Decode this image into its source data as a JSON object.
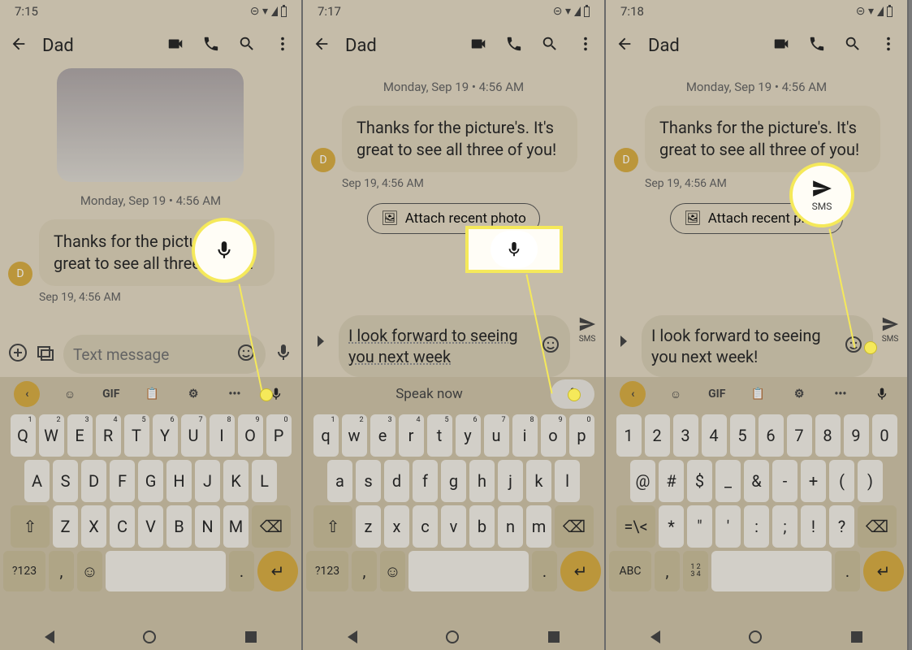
{
  "panels": [
    {
      "status_time": "7:15",
      "contact": "Dad",
      "date": "Monday, Sep 19  •  4:56 AM",
      "msg": "Thanks for the picture's. It's great to see all three of you!",
      "msg_ts": "Sep 19, 4:56 AM",
      "avatar": "D",
      "compose_placeholder": "Text message",
      "suggest": "",
      "kbd_rows": [
        [
          "Q",
          "W",
          "E",
          "R",
          "T",
          "Y",
          "U",
          "I",
          "O",
          "P"
        ],
        [
          "A",
          "S",
          "D",
          "F",
          "G",
          "H",
          "J",
          "K",
          "L"
        ],
        [
          "Z",
          "X",
          "C",
          "V",
          "B",
          "N",
          "M"
        ]
      ],
      "num_row": [
        "1",
        "2",
        "3",
        "4",
        "5",
        "6",
        "7",
        "8",
        "9",
        "0"
      ],
      "mode_key": "?123"
    },
    {
      "status_time": "7:17",
      "contact": "Dad",
      "date": "Monday, Sep 19  •  4:56 AM",
      "msg": "Thanks for the picture's. It's great to see all three of you!",
      "msg_ts": "Sep 19, 4:56 AM",
      "avatar": "D",
      "suggest": "Attach recent photo",
      "draft": "I look forward to seeing you next week",
      "speak": "Speak now",
      "kbd_rows": [
        [
          "q",
          "w",
          "e",
          "r",
          "t",
          "y",
          "u",
          "i",
          "o",
          "p"
        ],
        [
          "a",
          "s",
          "d",
          "f",
          "g",
          "h",
          "j",
          "k",
          "l"
        ],
        [
          "z",
          "x",
          "c",
          "v",
          "b",
          "n",
          "m"
        ]
      ],
      "num_row": [
        "1",
        "2",
        "3",
        "4",
        "5",
        "6",
        "7",
        "8",
        "9",
        "0"
      ],
      "mode_key": "?123",
      "send_label": "SMS"
    },
    {
      "status_time": "7:18",
      "contact": "Dad",
      "date": "Monday, Sep 19  •  4:56 AM",
      "msg": "Thanks for the picture's. It's great to see all three of you!",
      "msg_ts": "Sep 19, 4:56 AM",
      "avatar": "D",
      "suggest": "Attach recent photo",
      "draft": "I look forward to seeing you next week!",
      "kbd_rows": [
        [
          "1",
          "2",
          "3",
          "4",
          "5",
          "6",
          "7",
          "8",
          "9",
          "0"
        ],
        [
          "@",
          "#",
          "$",
          "_",
          "&",
          "-",
          "+",
          "(",
          ")"
        ],
        [
          "*",
          "\"",
          "'",
          ":",
          ";",
          "!",
          "?"
        ]
      ],
      "num_row": [
        "",
        "",
        "",
        "",
        "",
        "",
        "",
        "",
        "",
        ""
      ],
      "mode_key": "ABC",
      "alt_key": "=\\<",
      "special_key": "1 2\n3 4",
      "send_label": "SMS",
      "callout_label": "SMS"
    }
  ]
}
